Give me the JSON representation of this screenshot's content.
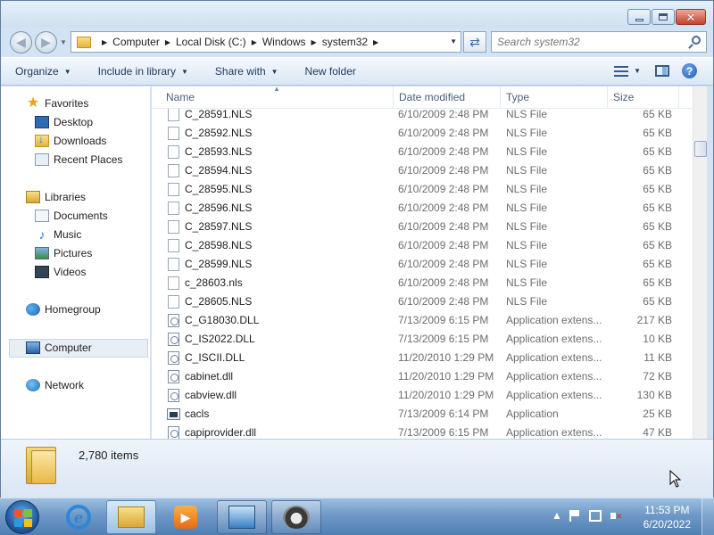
{
  "window": {
    "buttons": {
      "minimize": "minimize",
      "maximize": "maximize",
      "close": "close"
    }
  },
  "address_bar": {
    "breadcrumbs": [
      "Computer",
      "Local Disk (C:)",
      "Windows",
      "system32"
    ],
    "search_placeholder": "Search system32"
  },
  "toolbar": {
    "organize": "Organize",
    "include_in_library": "Include in library",
    "share_with": "Share with",
    "new_folder": "New folder"
  },
  "navigation": {
    "favorites": {
      "label": "Favorites",
      "items": [
        "Desktop",
        "Downloads",
        "Recent Places"
      ]
    },
    "libraries": {
      "label": "Libraries",
      "items": [
        "Documents",
        "Music",
        "Pictures",
        "Videos"
      ]
    },
    "homegroup": "Homegroup",
    "computer": "Computer",
    "network": "Network"
  },
  "columns": {
    "name": "Name",
    "date": "Date modified",
    "type": "Type",
    "size": "Size"
  },
  "files": [
    {
      "name": "C_28591.NLS",
      "date": "6/10/2009 2:48 PM",
      "type": "NLS File",
      "size": "65 KB",
      "icon": "file"
    },
    {
      "name": "C_28592.NLS",
      "date": "6/10/2009 2:48 PM",
      "type": "NLS File",
      "size": "65 KB",
      "icon": "file"
    },
    {
      "name": "C_28593.NLS",
      "date": "6/10/2009 2:48 PM",
      "type": "NLS File",
      "size": "65 KB",
      "icon": "file"
    },
    {
      "name": "C_28594.NLS",
      "date": "6/10/2009 2:48 PM",
      "type": "NLS File",
      "size": "65 KB",
      "icon": "file"
    },
    {
      "name": "C_28595.NLS",
      "date": "6/10/2009 2:48 PM",
      "type": "NLS File",
      "size": "65 KB",
      "icon": "file"
    },
    {
      "name": "C_28596.NLS",
      "date": "6/10/2009 2:48 PM",
      "type": "NLS File",
      "size": "65 KB",
      "icon": "file"
    },
    {
      "name": "C_28597.NLS",
      "date": "6/10/2009 2:48 PM",
      "type": "NLS File",
      "size": "65 KB",
      "icon": "file"
    },
    {
      "name": "C_28598.NLS",
      "date": "6/10/2009 2:48 PM",
      "type": "NLS File",
      "size": "65 KB",
      "icon": "file"
    },
    {
      "name": "C_28599.NLS",
      "date": "6/10/2009 2:48 PM",
      "type": "NLS File",
      "size": "65 KB",
      "icon": "file"
    },
    {
      "name": "c_28603.nls",
      "date": "6/10/2009 2:48 PM",
      "type": "NLS File",
      "size": "65 KB",
      "icon": "file"
    },
    {
      "name": "C_28605.NLS",
      "date": "6/10/2009 2:48 PM",
      "type": "NLS File",
      "size": "65 KB",
      "icon": "file"
    },
    {
      "name": "C_G18030.DLL",
      "date": "7/13/2009 6:15 PM",
      "type": "Application extens...",
      "size": "217 KB",
      "icon": "dll"
    },
    {
      "name": "C_IS2022.DLL",
      "date": "7/13/2009 6:15 PM",
      "type": "Application extens...",
      "size": "10 KB",
      "icon": "dll"
    },
    {
      "name": "C_ISCII.DLL",
      "date": "11/20/2010 1:29 PM",
      "type": "Application extens...",
      "size": "11 KB",
      "icon": "dll"
    },
    {
      "name": "cabinet.dll",
      "date": "11/20/2010 1:29 PM",
      "type": "Application extens...",
      "size": "72 KB",
      "icon": "dll"
    },
    {
      "name": "cabview.dll",
      "date": "11/20/2010 1:29 PM",
      "type": "Application extens...",
      "size": "130 KB",
      "icon": "dll"
    },
    {
      "name": "cacls",
      "date": "7/13/2009 6:14 PM",
      "type": "Application",
      "size": "25 KB",
      "icon": "app"
    },
    {
      "name": "capiprovider.dll",
      "date": "7/13/2009 6:15 PM",
      "type": "Application extens...",
      "size": "47 KB",
      "icon": "dll"
    }
  ],
  "details": {
    "item_count": "2,780 items"
  },
  "taskbar": {
    "apps": [
      "start-orb",
      "internet-explorer",
      "windows-explorer",
      "windows-media-player",
      "control-panel",
      "raccoon-app"
    ],
    "time": "11:53 PM",
    "date": "6/20/2022"
  },
  "colors": {
    "window_frame": "#d3e3f4",
    "taskbar": "#6f99c7",
    "selection": "#e8eef5"
  }
}
